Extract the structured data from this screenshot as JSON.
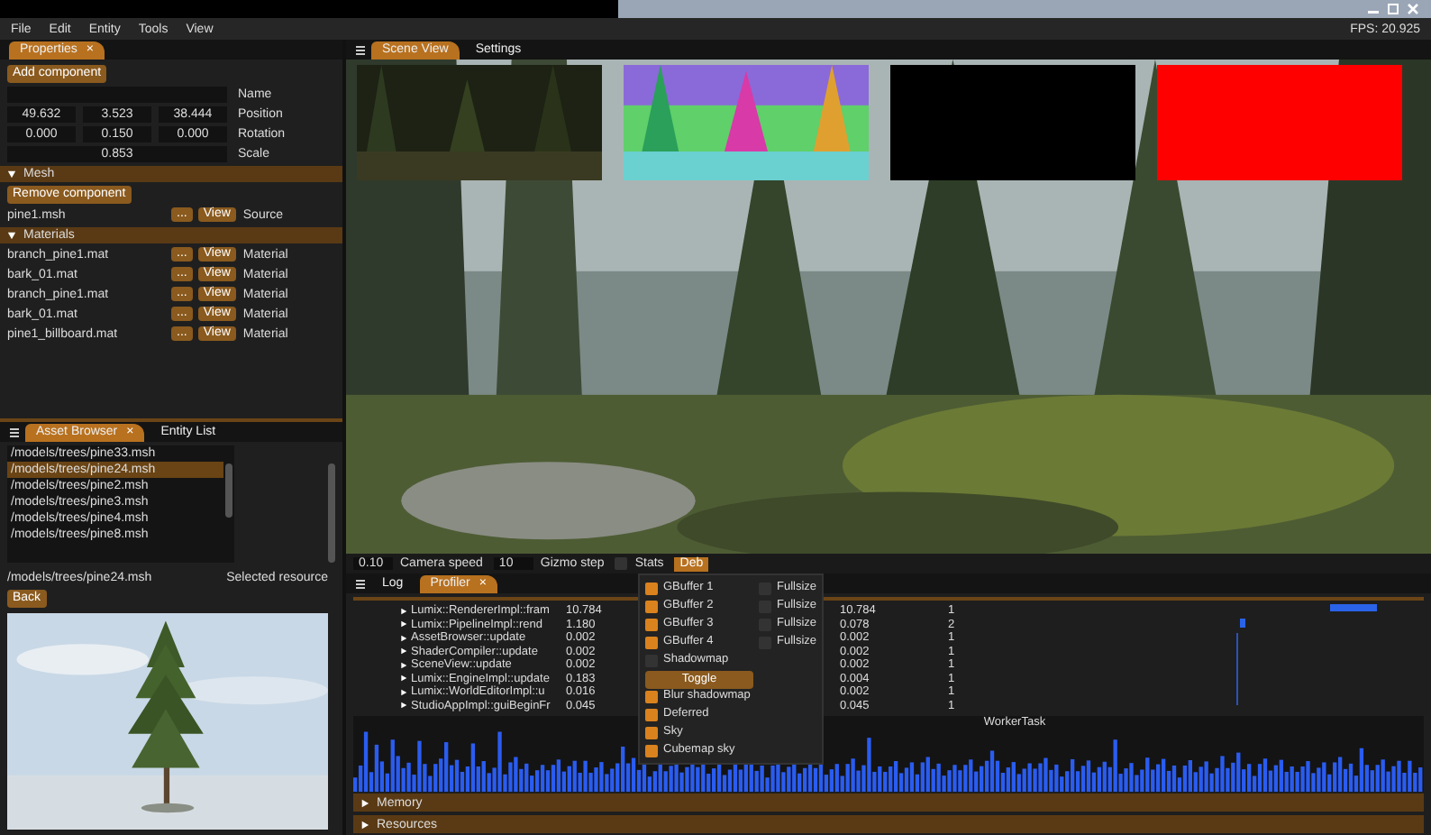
{
  "menu": [
    "File",
    "Edit",
    "Entity",
    "Tools",
    "View"
  ],
  "fps": "FPS: 20.925",
  "properties": {
    "tabs": [
      {
        "label": "Properties",
        "selected": true,
        "close": "×"
      }
    ],
    "add_component": "Add component",
    "fields": [
      {
        "kind": "text",
        "label": "Name"
      },
      {
        "kind": "vector",
        "label": "Position",
        "values": [
          "49.632",
          "3.523",
          "38.444"
        ]
      },
      {
        "kind": "vector",
        "label": "Rotation",
        "values": [
          "0.000",
          "0.150",
          "0.000"
        ]
      },
      {
        "kind": "scalar",
        "label": "Scale",
        "values": [
          "0.853"
        ]
      }
    ],
    "sections": [
      {
        "title": "Mesh",
        "expanded": true,
        "button": "Remove component",
        "rows": [
          {
            "name": "pine1.msh",
            "browse": "...",
            "view": "View",
            "label": "Source"
          }
        ]
      },
      {
        "title": "Materials",
        "expanded": true,
        "rows": [
          {
            "name": "branch_pine1.mat",
            "browse": "...",
            "view": "View",
            "label": "Material"
          },
          {
            "name": "bark_01.mat",
            "browse": "...",
            "view": "View",
            "label": "Material"
          },
          {
            "name": "branch_pine1.mat",
            "browse": "...",
            "view": "View",
            "label": "Material"
          },
          {
            "name": "bark_01.mat",
            "browse": "...",
            "view": "View",
            "label": "Material"
          },
          {
            "name": "pine1_billboard.mat",
            "browse": "...",
            "view": "View",
            "label": "Material"
          }
        ]
      }
    ]
  },
  "asset_browser": {
    "tabs": [
      {
        "label": "Asset Browser",
        "selected": true,
        "close": "×"
      },
      {
        "label": "Entity List",
        "selected": false
      }
    ],
    "files": [
      {
        "path": "/models/trees/pine33.msh",
        "selected": false
      },
      {
        "path": "/models/trees/pine24.msh",
        "selected": true
      },
      {
        "path": "/models/trees/pine2.msh",
        "selected": false
      },
      {
        "path": "/models/trees/pine3.msh",
        "selected": false
      },
      {
        "path": "/models/trees/pine4.msh",
        "selected": false
      },
      {
        "path": "/models/trees/pine8.msh",
        "selected": false
      }
    ],
    "selected_path": "/models/trees/pine24.msh",
    "selected_label": "Selected resource",
    "back": "Back",
    "preview": {
      "kind": "picture"
    }
  },
  "scene": {
    "tabs": [
      {
        "label": "Scene View",
        "selected": true
      },
      {
        "label": "Settings",
        "selected": false
      }
    ],
    "previews": [
      {
        "kind": "picture"
      },
      {
        "kind": "picture"
      },
      {
        "kind": "flat",
        "color": "#000000"
      },
      {
        "kind": "flat",
        "color": "#ff0000"
      }
    ],
    "toolbar": [
      {
        "kind": "field",
        "text": "0.10"
      },
      {
        "kind": "label",
        "text": "Camera speed"
      },
      {
        "kind": "field",
        "text": "10"
      },
      {
        "kind": "label",
        "text": "Gizmo step"
      },
      {
        "kind": "checkbox",
        "text": "Stats",
        "checked": false
      },
      {
        "kind": "button",
        "text": "Deb",
        "selected": true
      }
    ]
  },
  "debug_menu": [
    {
      "kind": "check",
      "label": "GBuffer 1",
      "checked": true,
      "extra": {
        "label": "Fullsize",
        "checked": false
      }
    },
    {
      "kind": "check",
      "label": "GBuffer 2",
      "checked": true,
      "extra": {
        "label": "Fullsize",
        "checked": false
      }
    },
    {
      "kind": "check",
      "label": "GBuffer 3",
      "checked": true,
      "extra": {
        "label": "Fullsize",
        "checked": false
      }
    },
    {
      "kind": "check",
      "label": "GBuffer 4",
      "checked": true,
      "extra": {
        "label": "Fullsize",
        "checked": false
      }
    },
    {
      "kind": "check",
      "label": "Shadowmap",
      "checked": false
    },
    {
      "kind": "button",
      "label": "Toggle"
    },
    {
      "kind": "check",
      "label": "Blur shadowmap",
      "checked": true
    },
    {
      "kind": "check",
      "label": "Deferred",
      "checked": true
    },
    {
      "kind": "check",
      "label": "Sky",
      "checked": true
    },
    {
      "kind": "check",
      "label": "Cubemap sky",
      "checked": true
    }
  ],
  "profiler": {
    "tabs": [
      {
        "label": "Log",
        "selected": false
      },
      {
        "label": "Profiler",
        "selected": true,
        "close": "×"
      }
    ],
    "rows": [
      {
        "name": "Lumix::RendererImpl::fram",
        "time": "10.784",
        "time_2": "10.784",
        "count": "1"
      },
      {
        "name": "Lumix::PipelineImpl::rend",
        "time": "1.180",
        "time_2": "0.078",
        "count": "2"
      },
      {
        "name": "AssetBrowser::update",
        "time": "0.002",
        "time_2": "0.002",
        "count": "1"
      },
      {
        "name": "ShaderCompiler::update",
        "time": "0.002",
        "time_2": "0.002",
        "count": "1"
      },
      {
        "name": "SceneView::update",
        "time": "0.002",
        "time_2": "0.002",
        "count": "1"
      },
      {
        "name": "Lumix::EngineImpl::update",
        "time": "0.183",
        "time_2": "0.004",
        "count": "1"
      },
      {
        "name": "Lumix::WorldEditorImpl::u",
        "time": "0.016",
        "time_2": "0.002",
        "count": "1"
      },
      {
        "name": "StudioAppImpl::guiBeginFr",
        "time": "0.045",
        "time_2": "0.045",
        "count": "1"
      }
    ],
    "graph_label": "WorkerTask",
    "headers": [
      {
        "title": "Memory",
        "expanded": false
      },
      {
        "title": "Resources",
        "expanded": false
      }
    ]
  }
}
